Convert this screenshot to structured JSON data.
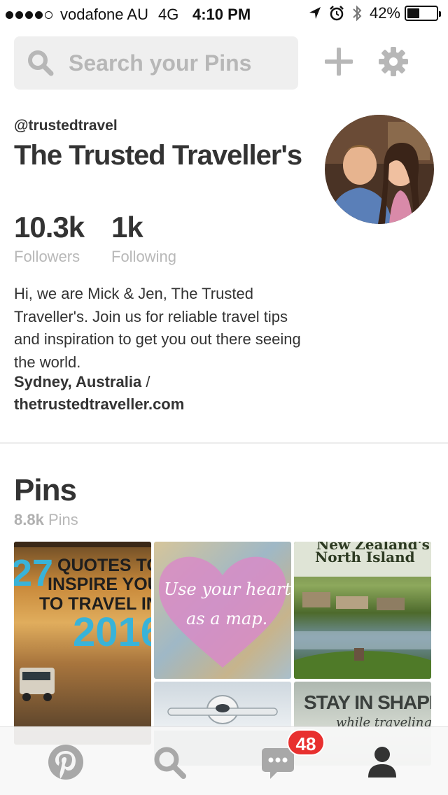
{
  "status_bar": {
    "carrier": "vodafone AU",
    "network": "4G",
    "time": "4:10 PM",
    "battery": "42%",
    "battery_level": 0.42,
    "signal_bars": 4,
    "icons": [
      "location-icon",
      "alarm-icon",
      "bluetooth-icon",
      "battery-icon"
    ]
  },
  "search": {
    "placeholder": "Search your Pins",
    "icon": "search-icon"
  },
  "header_actions": [
    "plus-icon",
    "gear-icon"
  ],
  "profile": {
    "username": "@trustedtravel",
    "name": "The Trusted Traveller's",
    "followers_count": "10.3k",
    "followers_label": "Followers",
    "following_count": "1k",
    "following_label": "Following",
    "bio": "Hi, we are Mick & Jen, The Trusted Traveller's. Join us for reliable travel tips and inspiration to get you out there seeing the world.",
    "location": "Sydney, Australia",
    "separator": "/",
    "website": "thetrustedtraveller.com"
  },
  "pins": {
    "title": "Pins",
    "count": "8.8k",
    "count_label": "Pins",
    "items": [
      {
        "text_top": "27",
        "text_lines": [
          "QUOTES TO",
          "INSPIRE YOU",
          "TO TRAVEL IN"
        ],
        "text_year": "2016"
      },
      {
        "text_lines": [
          "Use your heart",
          "as a map."
        ]
      },
      {
        "text_lines": [
          "New Zealand's",
          "North Island"
        ]
      },
      {
        "text_lines": []
      },
      {
        "text_lines": [
          "STAY IN SHAPE",
          "while traveling"
        ]
      }
    ]
  },
  "tab_bar": {
    "tabs": [
      "pinterest-icon",
      "search-icon",
      "messages-icon",
      "profile-icon"
    ],
    "notifications_badge": "48"
  },
  "colors": {
    "badge": "#e8302f",
    "muted_text": "#b8b8b8",
    "primary_text": "#333333",
    "search_bg": "#efefef"
  }
}
